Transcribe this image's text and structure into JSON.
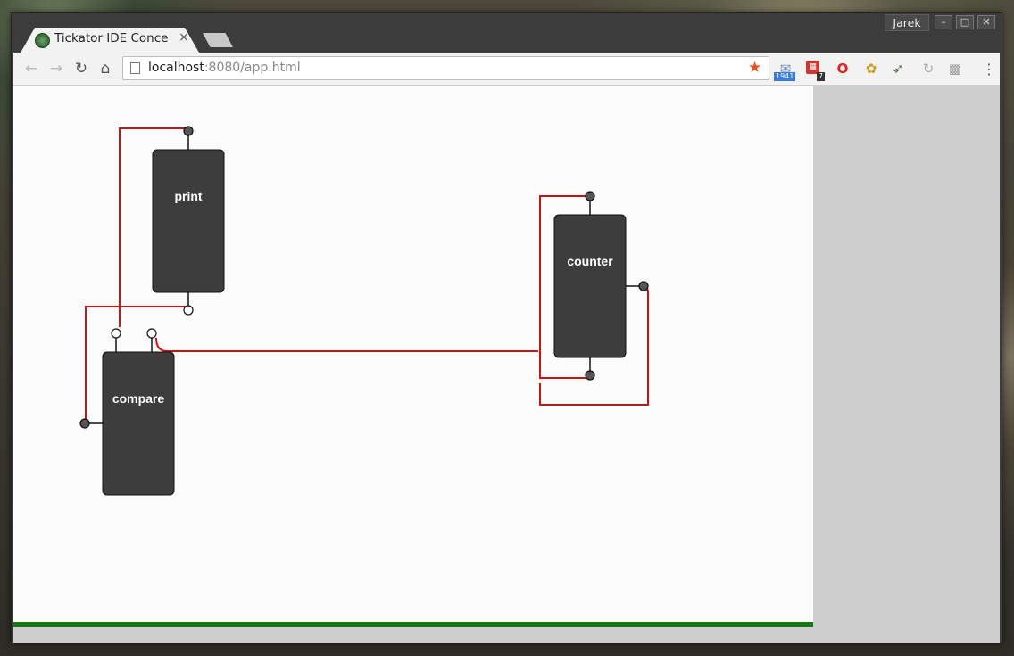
{
  "browser": {
    "tab_title": "Tickator IDE Conce",
    "tab_close": "×",
    "user_name": "Jarek",
    "window_buttons": {
      "minimize": "–",
      "maximize": "□",
      "close": "✕"
    },
    "url_host": "localhost",
    "url_rest": ":8080/app.html",
    "nav": {
      "back": "←",
      "forward": "→",
      "reload": "↻",
      "home": "⌂"
    },
    "extensions": [
      {
        "name": "mail-icon",
        "badge": "1941"
      },
      {
        "name": "todo-icon",
        "badge": "7"
      },
      {
        "name": "opera-icon",
        "badge": ""
      },
      {
        "name": "fruit-icon",
        "badge": ""
      },
      {
        "name": "bird-icon",
        "badge": ""
      },
      {
        "name": "refresh-ext-icon",
        "badge": ""
      },
      {
        "name": "grid-ext-icon",
        "badge": ""
      }
    ],
    "menu": "⋮"
  },
  "diagram": {
    "blocks": [
      {
        "id": "print",
        "label": "print"
      },
      {
        "id": "counter",
        "label": "counter"
      },
      {
        "id": "compare",
        "label": "compare"
      }
    ]
  },
  "colors": {
    "wire": "#cc1111",
    "block_fill": "#3d3d3d",
    "port_output": "#555555",
    "port_input": "#ffffff",
    "status_bar": "#0f7a0f"
  }
}
